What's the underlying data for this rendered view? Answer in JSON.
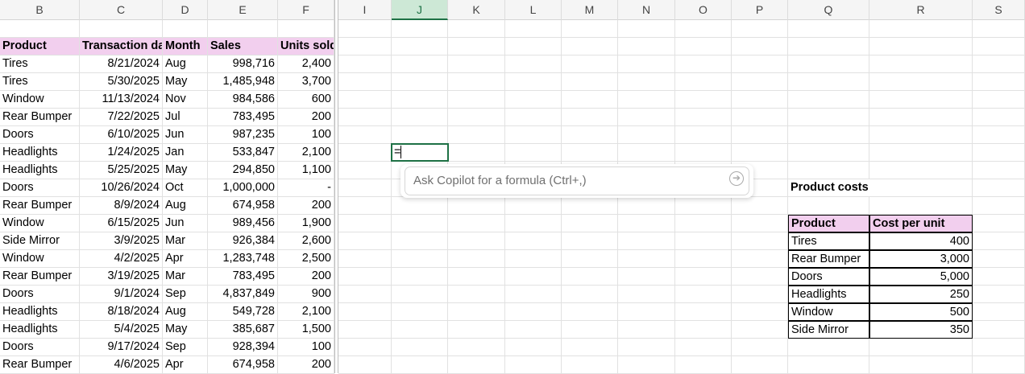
{
  "columns": [
    "B",
    "C",
    "D",
    "E",
    "F",
    "I",
    "J",
    "K",
    "L",
    "M",
    "N",
    "O",
    "P",
    "Q",
    "R",
    "S"
  ],
  "selected_column": "J",
  "sales_table": {
    "headers": [
      "Product",
      "Transaction dat",
      "Month",
      "Sales",
      "Units sold"
    ],
    "rows": [
      [
        "Tires",
        "8/21/2024",
        "Aug",
        "998,716",
        "2,400"
      ],
      [
        "Tires",
        "5/30/2025",
        "May",
        "1,485,948",
        "3,700"
      ],
      [
        "Window",
        "11/13/2024",
        "Nov",
        "984,586",
        "600"
      ],
      [
        "Rear Bumper",
        "7/22/2025",
        "Jul",
        "783,495",
        "200"
      ],
      [
        "Doors",
        "6/10/2025",
        "Jun",
        "987,235",
        "100"
      ],
      [
        "Headlights",
        "1/24/2025",
        "Jan",
        "533,847",
        "2,100"
      ],
      [
        "Headlights",
        "5/25/2025",
        "May",
        "294,850",
        "1,100"
      ],
      [
        "Doors",
        "10/26/2024",
        "Oct",
        "1,000,000",
        "-"
      ],
      [
        "Rear Bumper",
        "8/9/2024",
        "Aug",
        "674,958",
        "200"
      ],
      [
        "Window",
        "6/15/2025",
        "Jun",
        "989,456",
        "1,900"
      ],
      [
        "Side Mirror",
        "3/9/2025",
        "Mar",
        "926,384",
        "2,600"
      ],
      [
        "Window",
        "4/2/2025",
        "Apr",
        "1,283,748",
        "2,500"
      ],
      [
        "Rear Bumper",
        "3/19/2025",
        "Mar",
        "783,495",
        "200"
      ],
      [
        "Doors",
        "9/1/2024",
        "Sep",
        "4,837,849",
        "900"
      ],
      [
        "Headlights",
        "8/18/2024",
        "Aug",
        "549,728",
        "2,100"
      ],
      [
        "Headlights",
        "5/4/2025",
        "May",
        "385,687",
        "1,500"
      ],
      [
        "Doors",
        "9/17/2024",
        "Sep",
        "928,394",
        "100"
      ],
      [
        "Rear Bumper",
        "4/6/2025",
        "Apr",
        "674,958",
        "200"
      ]
    ]
  },
  "cost_table": {
    "title": "Product costs",
    "headers": [
      "Product",
      "Cost per unit"
    ],
    "rows": [
      [
        "Tires",
        "400"
      ],
      [
        "Rear Bumper",
        "3,000"
      ],
      [
        "Doors",
        "5,000"
      ],
      [
        "Headlights",
        "250"
      ],
      [
        "Window",
        "500"
      ],
      [
        "Side Mirror",
        "350"
      ]
    ]
  },
  "active_cell": {
    "value": "="
  },
  "copilot": {
    "placeholder": "Ask Copilot for a formula (Ctrl+,)",
    "send_icon": "arrow-right-circle-icon"
  },
  "colors": {
    "header_fill": "#f2cfee",
    "selection": "#1e7145"
  }
}
